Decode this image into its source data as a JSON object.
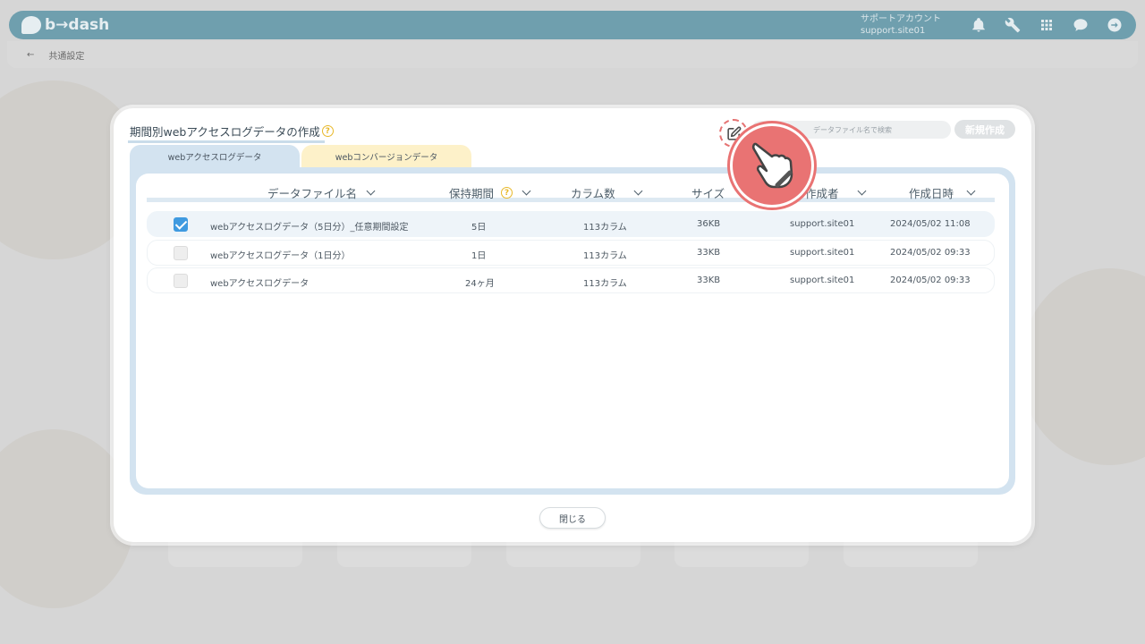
{
  "app": {
    "brand": "b→dash",
    "account_title": "サポートアカウント",
    "account_id": "support.site01",
    "breadcrumb": "共通設定"
  },
  "modal": {
    "title": "期間別webアクセスログデータの作成",
    "search_placeholder": "データファイル名で検索",
    "new_button": "新規作成",
    "close_button": "閉じる",
    "tabs": [
      {
        "label": "webアクセスログデータ",
        "active": true
      },
      {
        "label": "webコンバージョンデータ",
        "active": false
      }
    ],
    "columns": [
      "データファイル名",
      "保持期間",
      "カラム数",
      "サイズ",
      "作成者",
      "作成日時"
    ],
    "rows": [
      {
        "checked": true,
        "name": "webアクセスログデータ（5日分）_任意期間設定",
        "retention": "5日",
        "columns": "113カラム",
        "size": "36KB",
        "creator": "support.site01",
        "created": "2024/05/02 11:08"
      },
      {
        "checked": false,
        "name": "webアクセスログデータ（1日分）",
        "retention": "1日",
        "columns": "113カラム",
        "size": "33KB",
        "creator": "support.site01",
        "created": "2024/05/02 09:33"
      },
      {
        "checked": false,
        "name": "webアクセスログデータ",
        "retention": "24ヶ月",
        "columns": "113カラム",
        "size": "33KB",
        "creator": "support.site01",
        "created": "2024/05/02 09:33"
      }
    ]
  },
  "colors": {
    "accent": "#3f9ae0",
    "highlight": "#e97373",
    "tab_active": "#d3e3f0",
    "tab_inactive": "#fdf1c9",
    "header": "#6f9fae"
  },
  "icons": [
    "bell-icon",
    "wrench-icon",
    "grid-icon",
    "chat-icon",
    "logout-icon",
    "edit-icon",
    "search-icon",
    "help-icon",
    "chevron-down-icon",
    "hand-pointer-icon"
  ]
}
